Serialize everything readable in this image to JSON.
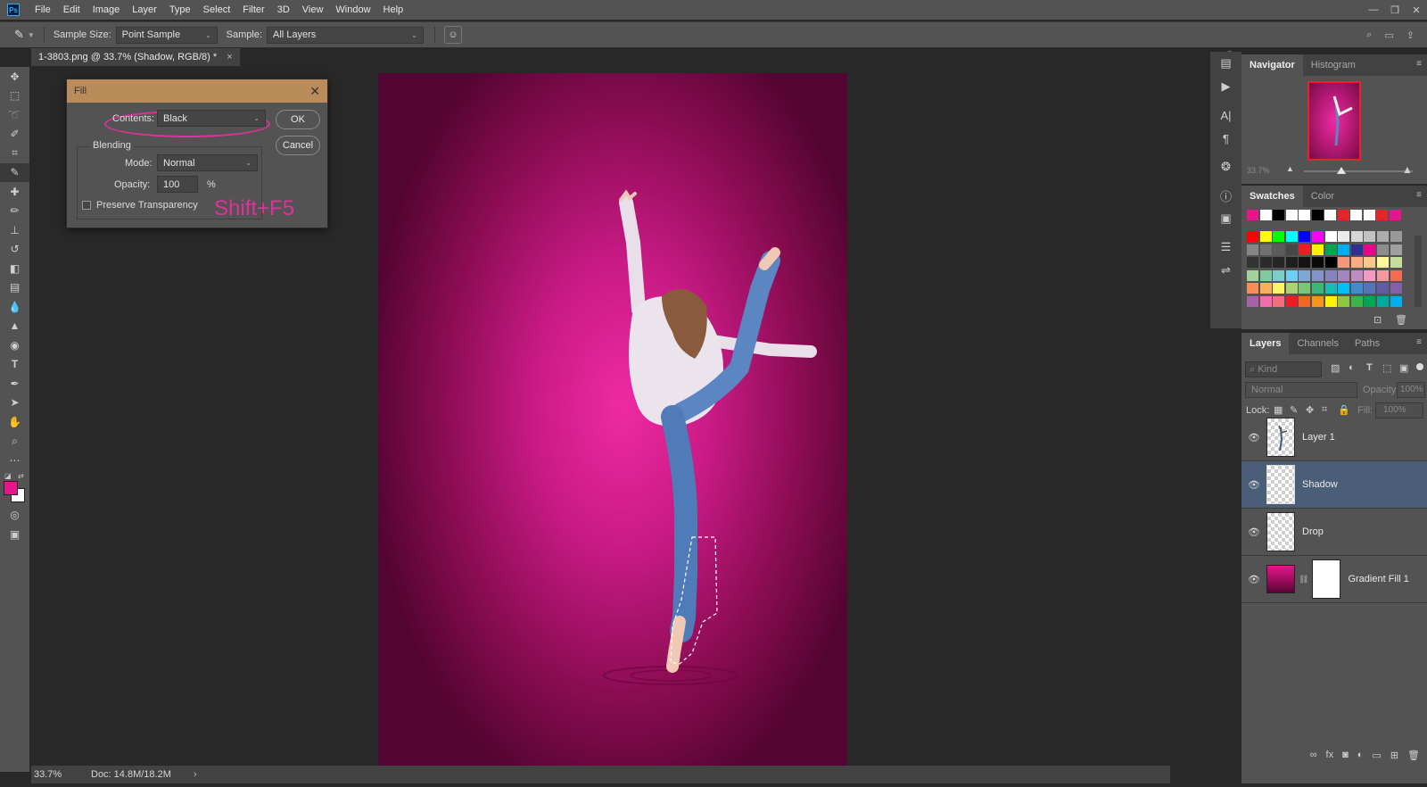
{
  "menubar": {
    "items": [
      "File",
      "Edit",
      "Image",
      "Layer",
      "Type",
      "Select",
      "Filter",
      "3D",
      "View",
      "Window",
      "Help"
    ]
  },
  "options": {
    "sample_size_label": "Sample Size:",
    "sample_size_value": "Point Sample",
    "sample_label": "Sample:",
    "sample_value": "All Layers"
  },
  "document": {
    "tab_title": "1-3803.png @ 33.7% (Shadow, RGB/8) *",
    "zoom": "33.7%",
    "doc_size": "Doc: 14.8M/18.2M"
  },
  "fill_dialog": {
    "title": "Fill",
    "contents_label": "Contents:",
    "contents_value": "Black",
    "ok_label": "OK",
    "cancel_label": "Cancel",
    "blending_label": "Blending",
    "mode_label": "Mode:",
    "mode_value": "Normal",
    "opacity_label": "Opacity:",
    "opacity_value": "100",
    "opacity_unit": "%",
    "preserve_label": "Preserve Transparency",
    "shortcut_annotation": "Shift+F5"
  },
  "navigator": {
    "tabs": [
      "Navigator",
      "Histogram"
    ],
    "zoom": "33.7%"
  },
  "swatches": {
    "tabs": [
      "Swatches",
      "Color"
    ]
  },
  "layers": {
    "tabs": [
      "Layers",
      "Channels",
      "Paths"
    ],
    "kind_placeholder": "Kind",
    "blend_mode": "Normal",
    "opacity_label": "Opacity:",
    "opacity_value": "100%",
    "lock_label": "Lock:",
    "fill_label": "Fill:",
    "fill_value": "100%",
    "items": [
      {
        "name": "Layer 1"
      },
      {
        "name": "Shadow"
      },
      {
        "name": "Drop"
      },
      {
        "name": "Gradient Fill 1"
      }
    ]
  },
  "colors": {
    "accent_annotation": "#e0309a",
    "dialog_titlebar": "#b98c5a",
    "selected_layer": "#4b5e78",
    "foreground": "#e8148c",
    "background": "#ffffff"
  }
}
